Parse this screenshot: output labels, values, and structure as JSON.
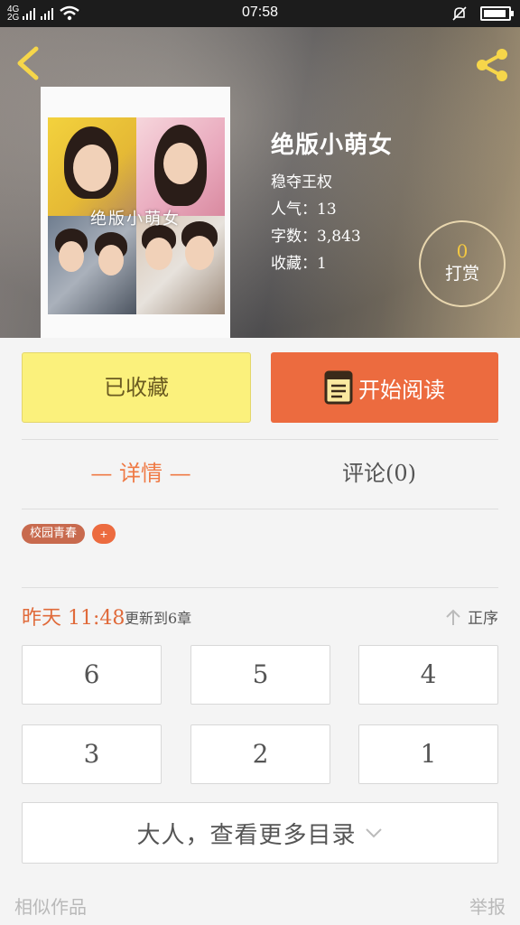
{
  "status_bar": {
    "network_1": "4G",
    "network_2": "2G",
    "time": "07:58"
  },
  "book": {
    "title": "绝版小萌女",
    "author": "稳夺王权",
    "popularity": "人气：13",
    "word_count": "字数：3,843",
    "favorites": "收藏：1",
    "cover_title": "绝版小萌女"
  },
  "reward": {
    "count": "0",
    "label": "打赏"
  },
  "actions": {
    "collect_label": "已收藏",
    "read_label": "开始阅读"
  },
  "tabs": {
    "detail": "— 详情 —",
    "comments": "评论(0)"
  },
  "tags": {
    "items": [
      "校园青春"
    ],
    "add": "+"
  },
  "update": {
    "time": "昨天 11:48",
    "text": "更新到6章",
    "sort_label": "正序"
  },
  "chapters": [
    "6",
    "5",
    "4",
    "3",
    "2",
    "1"
  ],
  "more_label": "大人，查看更多目录",
  "footer": {
    "similar": "相似作品",
    "report": "举报"
  },
  "colors": {
    "accent": "#ec6b3f",
    "collect_bg": "#fbf17c",
    "reward_number": "#f3c842"
  }
}
